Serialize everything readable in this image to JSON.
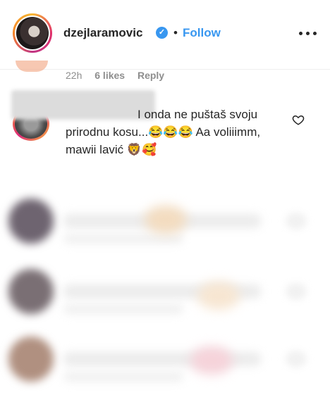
{
  "header": {
    "username": "dzejlaramovic",
    "verified_icon": "verified-badge-icon",
    "separator": "•",
    "follow_label": "Follow",
    "more_icon": "more-options-icon",
    "accent_color": "#3897f0"
  },
  "previous_comment": {
    "time": "22h",
    "likes": "6 likes",
    "reply_label": "Reply"
  },
  "comment": {
    "text": "I onda ne puštaš svoju prirodnu kosu...😂😂😂 Aa voliiimm, mawii lavić 🦁🥰",
    "like_icon": "heart-outline-icon"
  }
}
